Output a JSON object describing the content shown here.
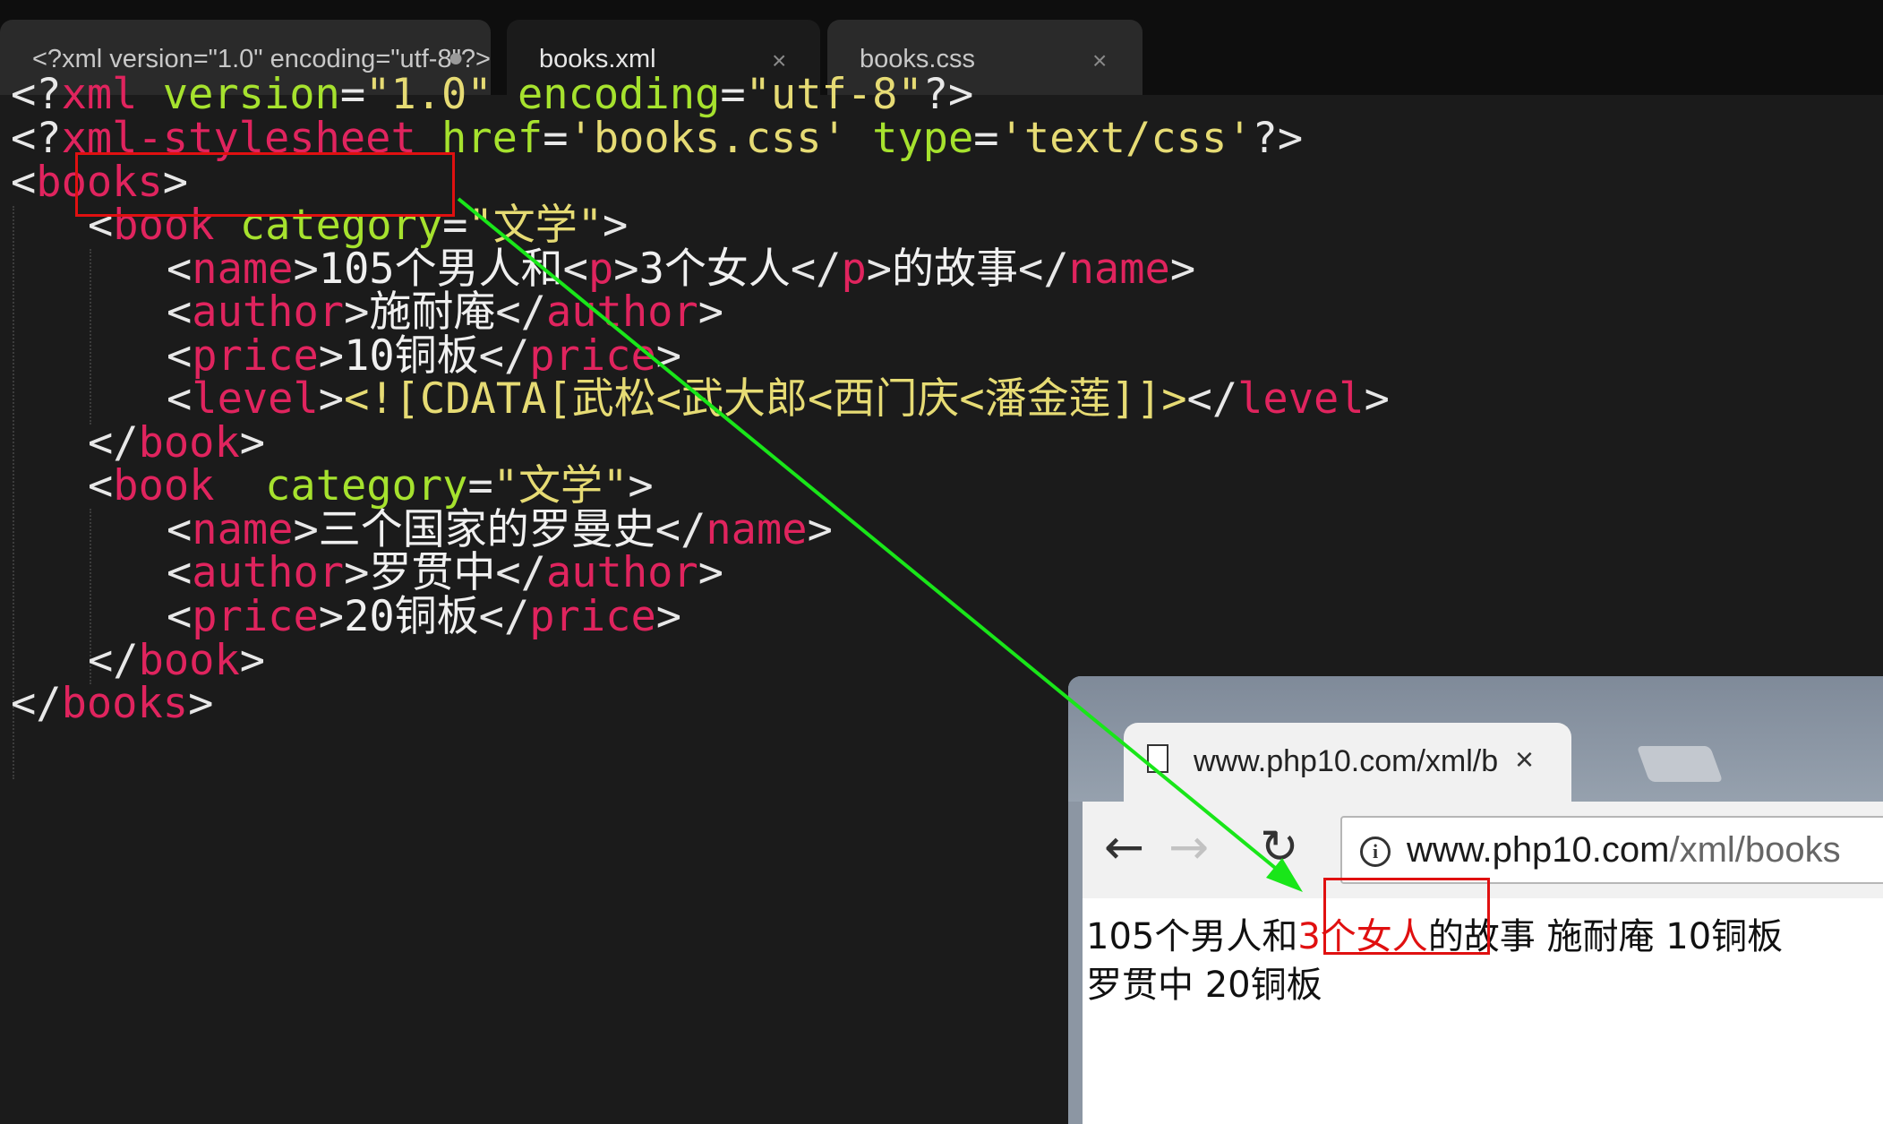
{
  "editor": {
    "tabs": [
      {
        "label": "<?xml version=\"1.0\" encoding=\"utf-8\"?>",
        "state": "unsaved",
        "dot": "●"
      },
      {
        "label": "books.xml",
        "state": "active",
        "close": "×"
      },
      {
        "label": "books.css",
        "state": "inactive",
        "close": "×"
      }
    ],
    "code": {
      "l1": {
        "p1": "<?",
        "tag": "xml",
        "a1": "version",
        "eq1": "=",
        "s1": "\"1.0\"",
        "a2": "encoding",
        "eq2": "=",
        "s2": "\"utf-8\"",
        "p2": "?>"
      },
      "l2": {
        "p1": "<?",
        "tag": "xml-stylesheet",
        "a1": "href",
        "eq1": "=",
        "s1": "'books.css'",
        "a2": "type",
        "eq2": "=",
        "s2": "'text/css'",
        "p2": "?>"
      },
      "l3": {
        "p1": "<",
        "tag": "books",
        "p2": ">"
      },
      "l4": {
        "p1": "<",
        "tag": "book",
        "a1": "category",
        "eq1": "=",
        "s1": "\"文学\"",
        "p2": ">"
      },
      "l5": {
        "p1": "<",
        "tag": "name",
        "p2": ">",
        "t1": "105个男人和",
        "p3": "<",
        "tag2": "p",
        "p4": ">",
        "t2": "3个女人",
        "p5": "</",
        "tag3": "p",
        "p6": ">",
        "t3": "的故事",
        "p7": "</",
        "tag4": "name",
        "p8": ">"
      },
      "l6": {
        "p1": "<",
        "tag": "author",
        "p2": ">",
        "t1": "施耐庵",
        "p3": "</",
        "tag2": "author",
        "p4": ">"
      },
      "l7": {
        "p1": "<",
        "tag": "price",
        "p2": ">",
        "t1": "10铜板",
        "p3": "</",
        "tag2": "price",
        "p4": ">"
      },
      "l8": {
        "p1": "<",
        "tag": "level",
        "p2": ">",
        "cdata": "<![CDATA[武松<武大郎<西门庆<潘金莲]]>",
        "p3": "</",
        "tag2": "level",
        "p4": ">"
      },
      "l9": {
        "p1": "</",
        "tag": "book",
        "p2": ">"
      },
      "l10": {
        "p1": "<",
        "tag": "book",
        "a1": "category",
        "eq1": "=",
        "s1": "\"文学\"",
        "p2": ">"
      },
      "l11": {
        "p1": "<",
        "tag": "name",
        "p2": ">",
        "t1": "三个国家的罗曼史",
        "p3": "</",
        "tag2": "name",
        "p4": ">"
      },
      "l12": {
        "p1": "<",
        "tag": "author",
        "p2": ">",
        "t1": "罗贯中",
        "p3": "</",
        "tag2": "author",
        "p4": ">"
      },
      "l13": {
        "p1": "<",
        "tag": "price",
        "p2": ">",
        "t1": "20铜板",
        "p3": "</",
        "tag2": "price",
        "p4": ">"
      },
      "l14": {
        "p1": "</",
        "tag": "book",
        "p2": ">"
      },
      "l15": {
        "p1": "</",
        "tag": "books",
        "p2": ">"
      }
    }
  },
  "browser": {
    "tab_title": "www.php10.com/xml/b",
    "tab_close": "×",
    "nav": {
      "back": "←",
      "forward": "→",
      "reload": "↻"
    },
    "url_domain": "www.php10.com",
    "url_path": "/xml/books",
    "info_icon": "i",
    "content": {
      "line1_before": "105个男人和",
      "line1_highlight": "3个女人",
      "line1_after": "的故事 施耐庵 10铜板",
      "line2": "罗贯中 20铜板"
    }
  },
  "colors": {
    "tag": "#e0245e",
    "attribute": "#a6e22e",
    "string": "#e6db74",
    "annotation_box": "#e01010",
    "annotation_arrow": "#19e619"
  }
}
